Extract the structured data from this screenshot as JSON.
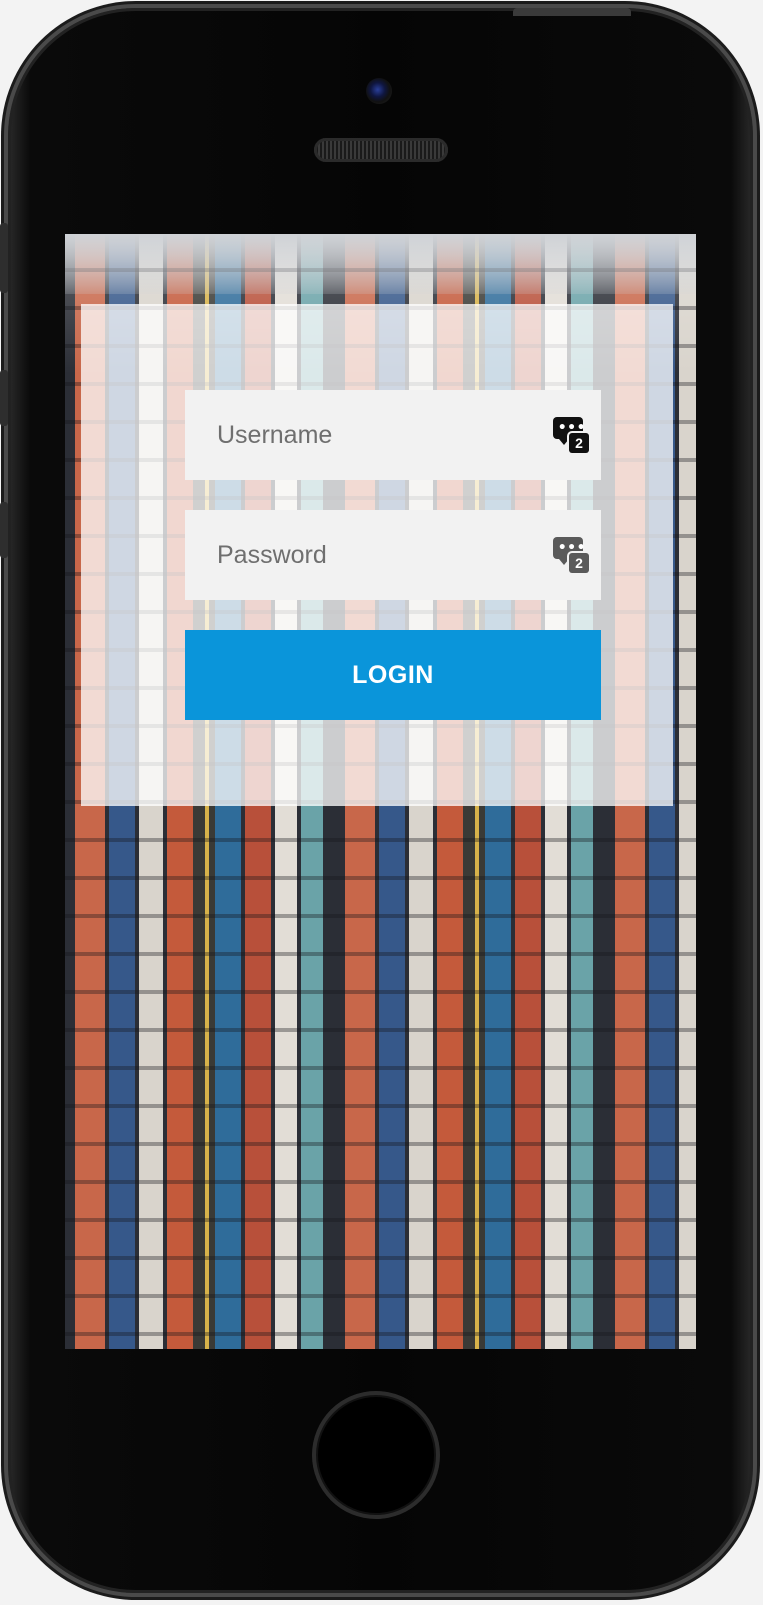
{
  "login_form": {
    "username_placeholder": "Username",
    "password_placeholder": "Password",
    "login_label": "LOGIN",
    "username_icon": "password-manager-icon",
    "password_icon": "password-manager-icon",
    "icon_badge": "2",
    "icon_dots": "•••"
  },
  "colors": {
    "login_button": "#0a95da",
    "field_background": "#f2f2f2",
    "panel_overlay": "rgba(255,255,255,0.76)"
  }
}
